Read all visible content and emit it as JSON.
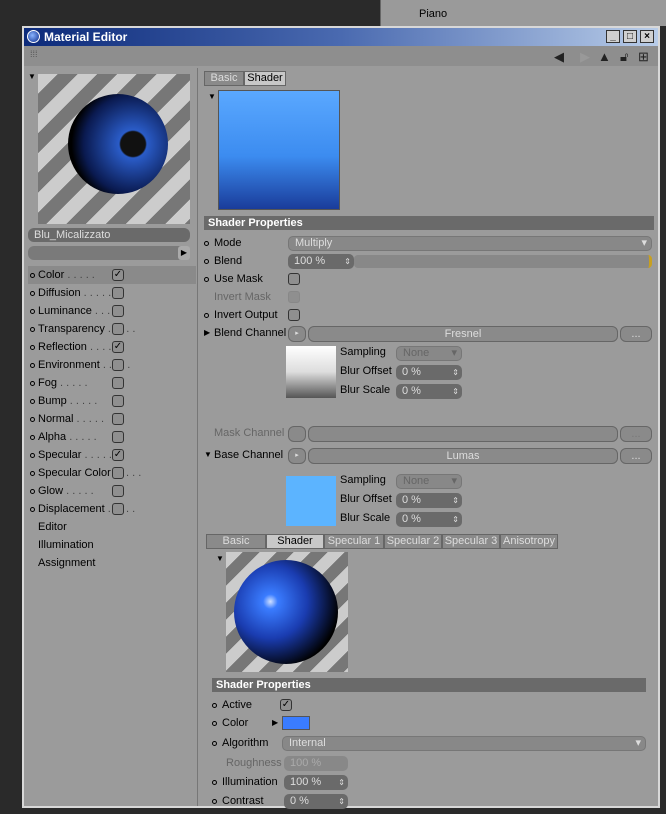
{
  "background": {
    "object_label": "Piano"
  },
  "window": {
    "title": "Material Editor"
  },
  "material": {
    "name": "Blu_Micalizzato"
  },
  "channels": [
    {
      "label": "Color",
      "checked": true,
      "selected": true
    },
    {
      "label": "Diffusion",
      "checked": false
    },
    {
      "label": "Luminance",
      "checked": false
    },
    {
      "label": "Transparency",
      "checked": false
    },
    {
      "label": "Reflection",
      "checked": true
    },
    {
      "label": "Environment",
      "checked": false
    },
    {
      "label": "Fog",
      "checked": false
    },
    {
      "label": "Bump",
      "checked": false
    },
    {
      "label": "Normal",
      "checked": false
    },
    {
      "label": "Alpha",
      "checked": false
    },
    {
      "label": "Specular",
      "checked": true
    },
    {
      "label": "Specular Color",
      "checked": false
    },
    {
      "label": "Glow",
      "checked": false
    },
    {
      "label": "Displacement",
      "checked": false
    },
    {
      "label": "Editor"
    },
    {
      "label": "Illumination"
    },
    {
      "label": "Assignment"
    }
  ],
  "top_tabs": [
    "Basic",
    "Shader"
  ],
  "shader": {
    "section": "Shader Properties",
    "mode_label": "Mode",
    "mode_value": "Multiply",
    "blend_label": "Blend",
    "blend_value": "100 %",
    "blend_fraction": 1.0,
    "use_mask": "Use Mask",
    "invert_mask": "Invert Mask",
    "invert_output": "Invert Output",
    "blend_channel": "Blend Channel",
    "blend_shader": "Fresnel",
    "mask_channel": "Mask Channel",
    "base_channel": "Base Channel",
    "base_shader": "Lumas",
    "sampling": "Sampling",
    "sampling_value": "None",
    "blur_offset": "Blur Offset",
    "blur_scale": "Blur Scale",
    "zero": "0 %",
    "more": "..."
  },
  "lumas_tabs": [
    "Basic",
    "Shader",
    "Specular 1",
    "Specular 2",
    "Specular 3",
    "Anisotropy"
  ],
  "lumas": {
    "section": "Shader Properties",
    "active": "Active",
    "color": "Color",
    "color_hex": "#3a7cff",
    "algorithm": "Algorithm",
    "algorithm_value": "Internal",
    "roughness": "Roughness",
    "roughness_value": "100 %",
    "illumination": "Illumination",
    "illumination_value": "100 %",
    "contrast": "Contrast",
    "contrast_value": "0 %"
  }
}
